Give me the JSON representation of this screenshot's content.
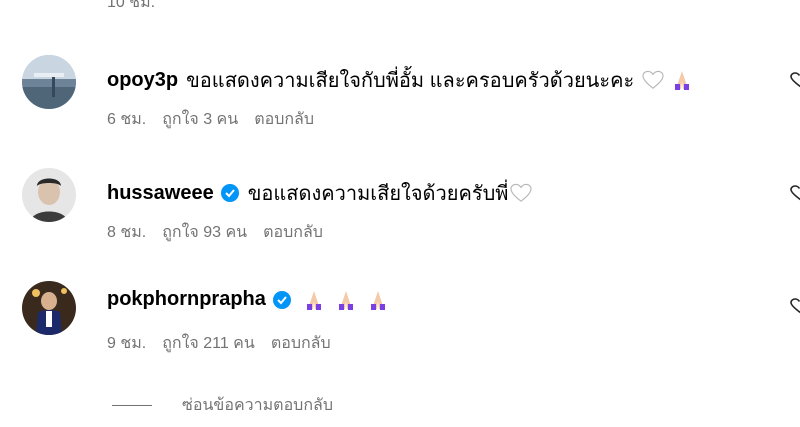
{
  "top_meta": "10 ชม.",
  "comments": [
    {
      "username": "opoy3p",
      "verified": false,
      "text": "ขอแสดงความเสียใจกับพี่อั้ม และครอบครัวด้วยนะคะ",
      "emojis": [
        "white-heart",
        "folded-hands"
      ],
      "time": "6 ชม.",
      "likes": "ถูกใจ 3 คน",
      "reply": "ตอบกลับ"
    },
    {
      "username": "hussaweee",
      "verified": true,
      "text": "ขอแสดงความเสียใจด้วยครับพี่",
      "emojis": [
        "white-heart"
      ],
      "time": "8 ชม.",
      "likes": "ถูกใจ 93 คน",
      "reply": "ตอบกลับ"
    },
    {
      "username": "pokphornprapha",
      "verified": true,
      "text": "",
      "emojis": [
        "folded-hands",
        "folded-hands",
        "folded-hands"
      ],
      "time": "9 ชม.",
      "likes": "ถูกใจ 211 คน",
      "reply": "ตอบกลับ"
    }
  ],
  "hide_replies": "ซ่อนข้อความตอบกลับ",
  "colors": {
    "verified": "#0095f6",
    "meta": "#737373",
    "emoji_purple": "#7b3fe4"
  }
}
